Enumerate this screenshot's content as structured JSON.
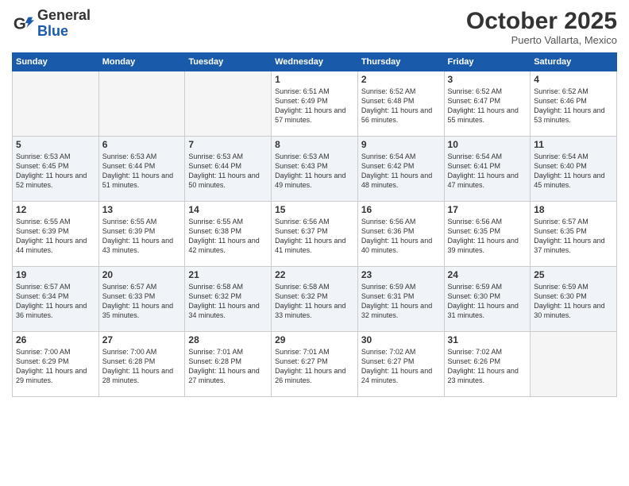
{
  "logo": {
    "general": "General",
    "blue": "Blue"
  },
  "header": {
    "month": "October 2025",
    "location": "Puerto Vallarta, Mexico"
  },
  "weekdays": [
    "Sunday",
    "Monday",
    "Tuesday",
    "Wednesday",
    "Thursday",
    "Friday",
    "Saturday"
  ],
  "weeks": [
    [
      {
        "day": "",
        "empty": true
      },
      {
        "day": "",
        "empty": true
      },
      {
        "day": "",
        "empty": true
      },
      {
        "day": "1",
        "sunrise": "Sunrise: 6:51 AM",
        "sunset": "Sunset: 6:49 PM",
        "daylight": "Daylight: 11 hours and 57 minutes."
      },
      {
        "day": "2",
        "sunrise": "Sunrise: 6:52 AM",
        "sunset": "Sunset: 6:48 PM",
        "daylight": "Daylight: 11 hours and 56 minutes."
      },
      {
        "day": "3",
        "sunrise": "Sunrise: 6:52 AM",
        "sunset": "Sunset: 6:47 PM",
        "daylight": "Daylight: 11 hours and 55 minutes."
      },
      {
        "day": "4",
        "sunrise": "Sunrise: 6:52 AM",
        "sunset": "Sunset: 6:46 PM",
        "daylight": "Daylight: 11 hours and 53 minutes."
      }
    ],
    [
      {
        "day": "5",
        "sunrise": "Sunrise: 6:53 AM",
        "sunset": "Sunset: 6:45 PM",
        "daylight": "Daylight: 11 hours and 52 minutes."
      },
      {
        "day": "6",
        "sunrise": "Sunrise: 6:53 AM",
        "sunset": "Sunset: 6:44 PM",
        "daylight": "Daylight: 11 hours and 51 minutes."
      },
      {
        "day": "7",
        "sunrise": "Sunrise: 6:53 AM",
        "sunset": "Sunset: 6:44 PM",
        "daylight": "Daylight: 11 hours and 50 minutes."
      },
      {
        "day": "8",
        "sunrise": "Sunrise: 6:53 AM",
        "sunset": "Sunset: 6:43 PM",
        "daylight": "Daylight: 11 hours and 49 minutes."
      },
      {
        "day": "9",
        "sunrise": "Sunrise: 6:54 AM",
        "sunset": "Sunset: 6:42 PM",
        "daylight": "Daylight: 11 hours and 48 minutes."
      },
      {
        "day": "10",
        "sunrise": "Sunrise: 6:54 AM",
        "sunset": "Sunset: 6:41 PM",
        "daylight": "Daylight: 11 hours and 47 minutes."
      },
      {
        "day": "11",
        "sunrise": "Sunrise: 6:54 AM",
        "sunset": "Sunset: 6:40 PM",
        "daylight": "Daylight: 11 hours and 45 minutes."
      }
    ],
    [
      {
        "day": "12",
        "sunrise": "Sunrise: 6:55 AM",
        "sunset": "Sunset: 6:39 PM",
        "daylight": "Daylight: 11 hours and 44 minutes."
      },
      {
        "day": "13",
        "sunrise": "Sunrise: 6:55 AM",
        "sunset": "Sunset: 6:39 PM",
        "daylight": "Daylight: 11 hours and 43 minutes."
      },
      {
        "day": "14",
        "sunrise": "Sunrise: 6:55 AM",
        "sunset": "Sunset: 6:38 PM",
        "daylight": "Daylight: 11 hours and 42 minutes."
      },
      {
        "day": "15",
        "sunrise": "Sunrise: 6:56 AM",
        "sunset": "Sunset: 6:37 PM",
        "daylight": "Daylight: 11 hours and 41 minutes."
      },
      {
        "day": "16",
        "sunrise": "Sunrise: 6:56 AM",
        "sunset": "Sunset: 6:36 PM",
        "daylight": "Daylight: 11 hours and 40 minutes."
      },
      {
        "day": "17",
        "sunrise": "Sunrise: 6:56 AM",
        "sunset": "Sunset: 6:35 PM",
        "daylight": "Daylight: 11 hours and 39 minutes."
      },
      {
        "day": "18",
        "sunrise": "Sunrise: 6:57 AM",
        "sunset": "Sunset: 6:35 PM",
        "daylight": "Daylight: 11 hours and 37 minutes."
      }
    ],
    [
      {
        "day": "19",
        "sunrise": "Sunrise: 6:57 AM",
        "sunset": "Sunset: 6:34 PM",
        "daylight": "Daylight: 11 hours and 36 minutes."
      },
      {
        "day": "20",
        "sunrise": "Sunrise: 6:57 AM",
        "sunset": "Sunset: 6:33 PM",
        "daylight": "Daylight: 11 hours and 35 minutes."
      },
      {
        "day": "21",
        "sunrise": "Sunrise: 6:58 AM",
        "sunset": "Sunset: 6:32 PM",
        "daylight": "Daylight: 11 hours and 34 minutes."
      },
      {
        "day": "22",
        "sunrise": "Sunrise: 6:58 AM",
        "sunset": "Sunset: 6:32 PM",
        "daylight": "Daylight: 11 hours and 33 minutes."
      },
      {
        "day": "23",
        "sunrise": "Sunrise: 6:59 AM",
        "sunset": "Sunset: 6:31 PM",
        "daylight": "Daylight: 11 hours and 32 minutes."
      },
      {
        "day": "24",
        "sunrise": "Sunrise: 6:59 AM",
        "sunset": "Sunset: 6:30 PM",
        "daylight": "Daylight: 11 hours and 31 minutes."
      },
      {
        "day": "25",
        "sunrise": "Sunrise: 6:59 AM",
        "sunset": "Sunset: 6:30 PM",
        "daylight": "Daylight: 11 hours and 30 minutes."
      }
    ],
    [
      {
        "day": "26",
        "sunrise": "Sunrise: 7:00 AM",
        "sunset": "Sunset: 6:29 PM",
        "daylight": "Daylight: 11 hours and 29 minutes."
      },
      {
        "day": "27",
        "sunrise": "Sunrise: 7:00 AM",
        "sunset": "Sunset: 6:28 PM",
        "daylight": "Daylight: 11 hours and 28 minutes."
      },
      {
        "day": "28",
        "sunrise": "Sunrise: 7:01 AM",
        "sunset": "Sunset: 6:28 PM",
        "daylight": "Daylight: 11 hours and 27 minutes."
      },
      {
        "day": "29",
        "sunrise": "Sunrise: 7:01 AM",
        "sunset": "Sunset: 6:27 PM",
        "daylight": "Daylight: 11 hours and 26 minutes."
      },
      {
        "day": "30",
        "sunrise": "Sunrise: 7:02 AM",
        "sunset": "Sunset: 6:27 PM",
        "daylight": "Daylight: 11 hours and 24 minutes."
      },
      {
        "day": "31",
        "sunrise": "Sunrise: 7:02 AM",
        "sunset": "Sunset: 6:26 PM",
        "daylight": "Daylight: 11 hours and 23 minutes."
      },
      {
        "day": "",
        "empty": true
      }
    ]
  ]
}
